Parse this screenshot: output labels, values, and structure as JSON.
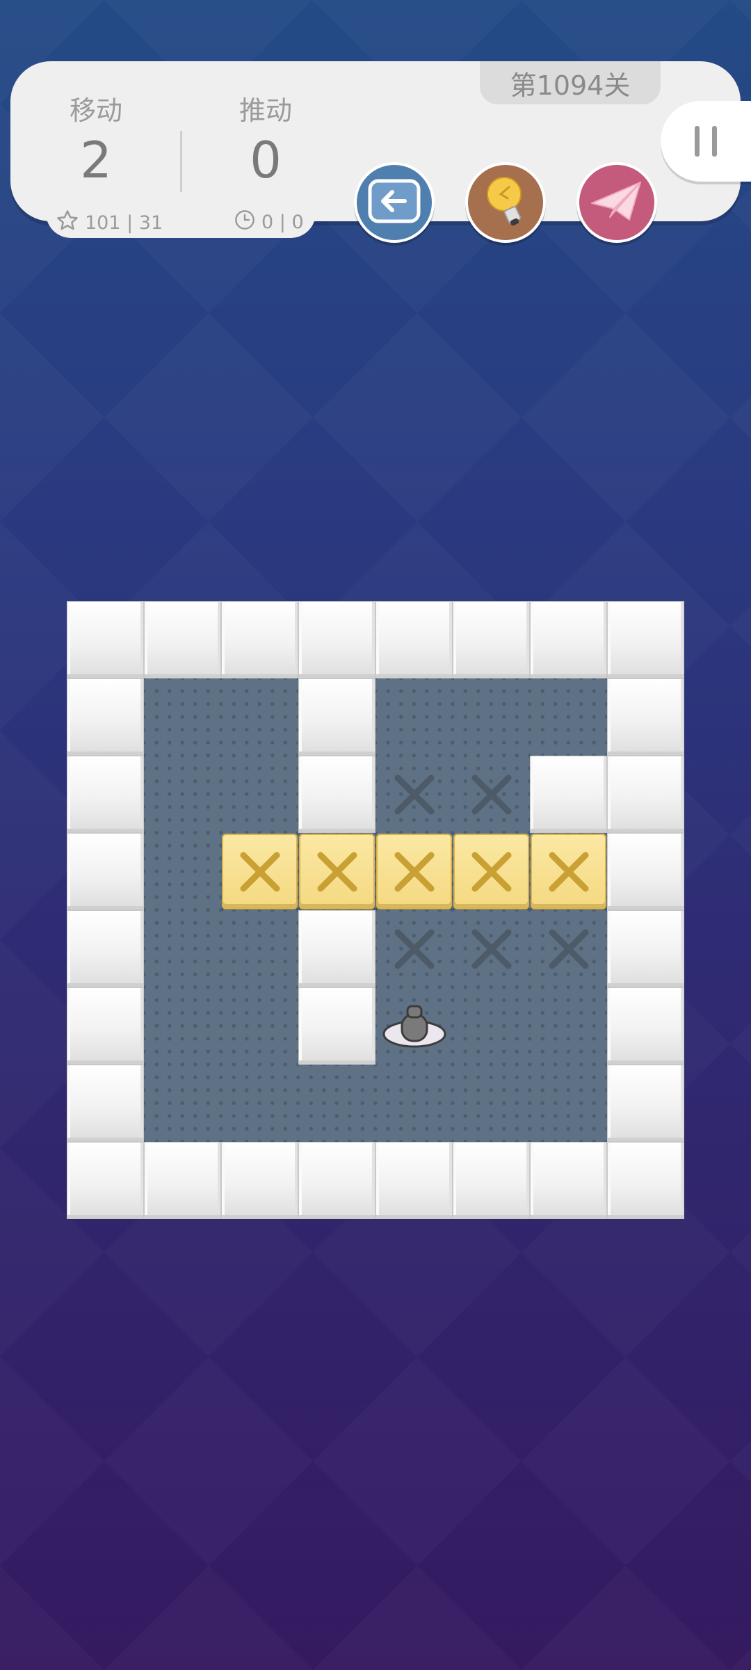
{
  "hud": {
    "moves_label": "移动",
    "moves_value": "2",
    "pushes_label": "推动",
    "pushes_value": "0",
    "star_stat": "101 | 31",
    "time_stat": "0 | 0",
    "level_title": "第1094关"
  },
  "buttons": {
    "undo_icon": "back-arrow-icon",
    "hint_icon": "lightbulb-icon",
    "share_icon": "paper-plane-icon",
    "pause_icon": "pause-icon"
  },
  "colors": {
    "undo": "#4f7fae",
    "hint": "#a66f4e",
    "share": "#c45a7c",
    "box": "#f5d981",
    "floor": "#5e7185"
  },
  "board": {
    "grid": [
      "WWWWWWWW",
      "W..W...W",
      "W..WttWW",
      "W.BBBBBW",
      "W..WtttW",
      "W..WP..W",
      "W......W",
      "WWWWWWWW"
    ]
  }
}
